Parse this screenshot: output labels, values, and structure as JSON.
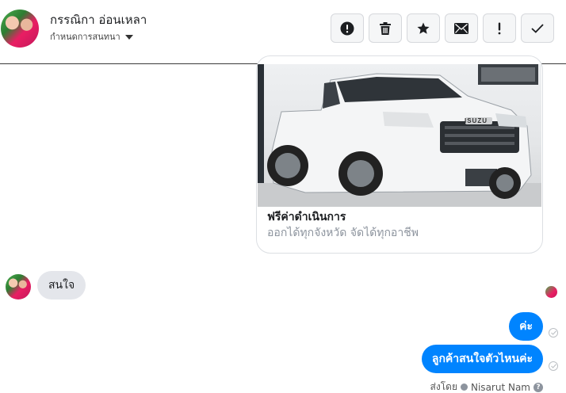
{
  "header": {
    "contact_name": "กรรณิกา อ่อนเหลา",
    "settings_label": "กำหนดการสนทนา",
    "actions": [
      {
        "icon": "alert-icon"
      },
      {
        "icon": "trash-icon"
      },
      {
        "icon": "star-icon"
      },
      {
        "icon": "envelope-icon"
      },
      {
        "icon": "exclamation-icon"
      },
      {
        "icon": "check-icon"
      }
    ]
  },
  "card": {
    "title": "ฟรีค่าดำเนินการ",
    "subtitle": "ออกได้ทุกจังหวัด จัดได้ทุกอาชีพ",
    "image_brand": "ISUZU"
  },
  "messages": {
    "incoming": [
      {
        "text": "สนใจ"
      }
    ],
    "outgoing": [
      {
        "text": "ค่ะ"
      },
      {
        "text": "ลูกค้าสนใจตัวไหนค่ะ"
      }
    ]
  },
  "sent_by": {
    "prefix": "ส่งโดย",
    "name": "Nisarut Nam",
    "help": "?"
  },
  "colors": {
    "outgoing_bubble": "#0084ff",
    "incoming_bubble": "#e4e6eb"
  }
}
